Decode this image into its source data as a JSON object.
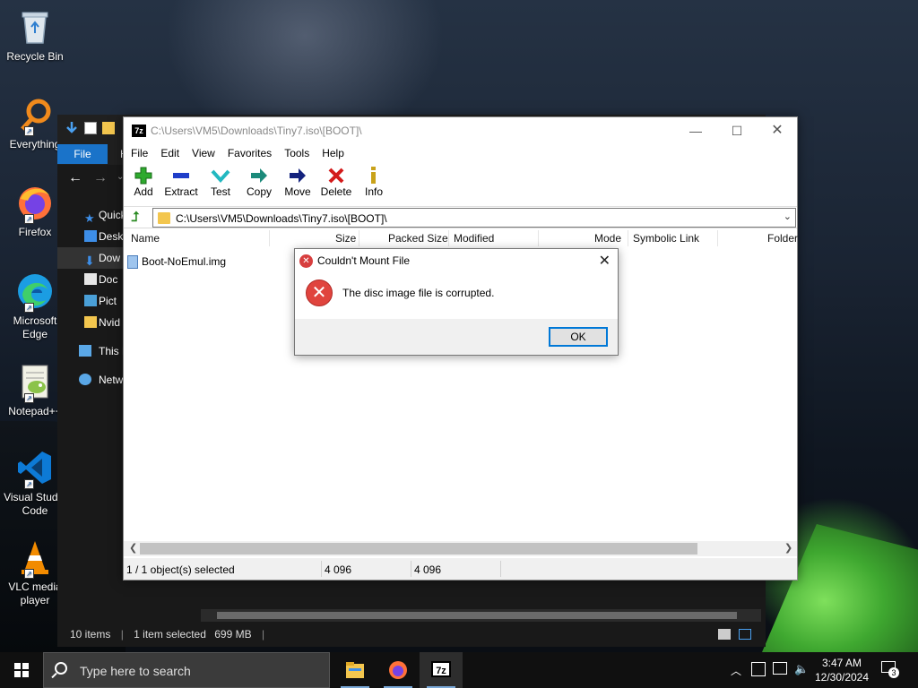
{
  "desktop": {
    "icons": [
      {
        "label": "Recycle Bin"
      },
      {
        "label": "Everything"
      },
      {
        "label": "Firefox"
      },
      {
        "label": "Microsoft Edge"
      },
      {
        "label": "Notepad++"
      },
      {
        "label": "Visual Studio Code"
      },
      {
        "label": "VLC media player"
      }
    ]
  },
  "explorer": {
    "file_tab": "File",
    "home_tab_partial": "H",
    "sidebar": [
      {
        "label": "Quick"
      },
      {
        "label": "Desk"
      },
      {
        "label": "Dow"
      },
      {
        "label": "Doc"
      },
      {
        "label": "Pict"
      },
      {
        "label": "Nvid"
      },
      {
        "label": "This P"
      },
      {
        "label": "Netw"
      }
    ],
    "status": {
      "items": "10 items",
      "selected": "1 item selected",
      "size": "699 MB"
    }
  },
  "zip": {
    "title": "C:\\Users\\VM5\\Downloads\\Tiny7.iso\\[BOOT]\\",
    "app_icon": "7z",
    "menu": [
      "File",
      "Edit",
      "View",
      "Favorites",
      "Tools",
      "Help"
    ],
    "toolbar": [
      {
        "label": "Add",
        "icon": "plus-icon",
        "color": "#2eaa2e"
      },
      {
        "label": "Extract",
        "icon": "minus-icon",
        "color": "#1f3ec9"
      },
      {
        "label": "Test",
        "icon": "check-icon",
        "color": "#22b8c0"
      },
      {
        "label": "Copy",
        "icon": "copy-arrow-icon",
        "color": "#1c8a7a"
      },
      {
        "label": "Move",
        "icon": "move-arrow-icon",
        "color": "#14237e"
      },
      {
        "label": "Delete",
        "icon": "x-icon",
        "color": "#d31a1a"
      },
      {
        "label": "Info",
        "icon": "info-icon",
        "color": "#c9a21a"
      }
    ],
    "address": "C:\\Users\\VM5\\Downloads\\Tiny7.iso\\[BOOT]\\",
    "columns": {
      "name": "Name",
      "size": "Size",
      "packed": "Packed Size",
      "modified": "Modified",
      "mode": "Mode",
      "symlink": "Symbolic Link",
      "folder": "Folder"
    },
    "files": [
      {
        "name": "Boot-NoEmul.img"
      }
    ],
    "status": {
      "selection": "1 / 1 object(s) selected",
      "size": "4 096",
      "packed": "4 096"
    }
  },
  "dialog": {
    "title": "Couldn't Mount File",
    "message": "The disc image file is corrupted.",
    "ok": "OK"
  },
  "taskbar": {
    "search_placeholder": "Type here to search",
    "pinned_7zip": "7z",
    "clock_time": "3:47 AM",
    "clock_date": "12/30/2024",
    "notification_count": "3"
  },
  "colors": {
    "accent": "#0078d7",
    "error": "#e0443e",
    "explorer_file_tab": "#1a73c9"
  }
}
